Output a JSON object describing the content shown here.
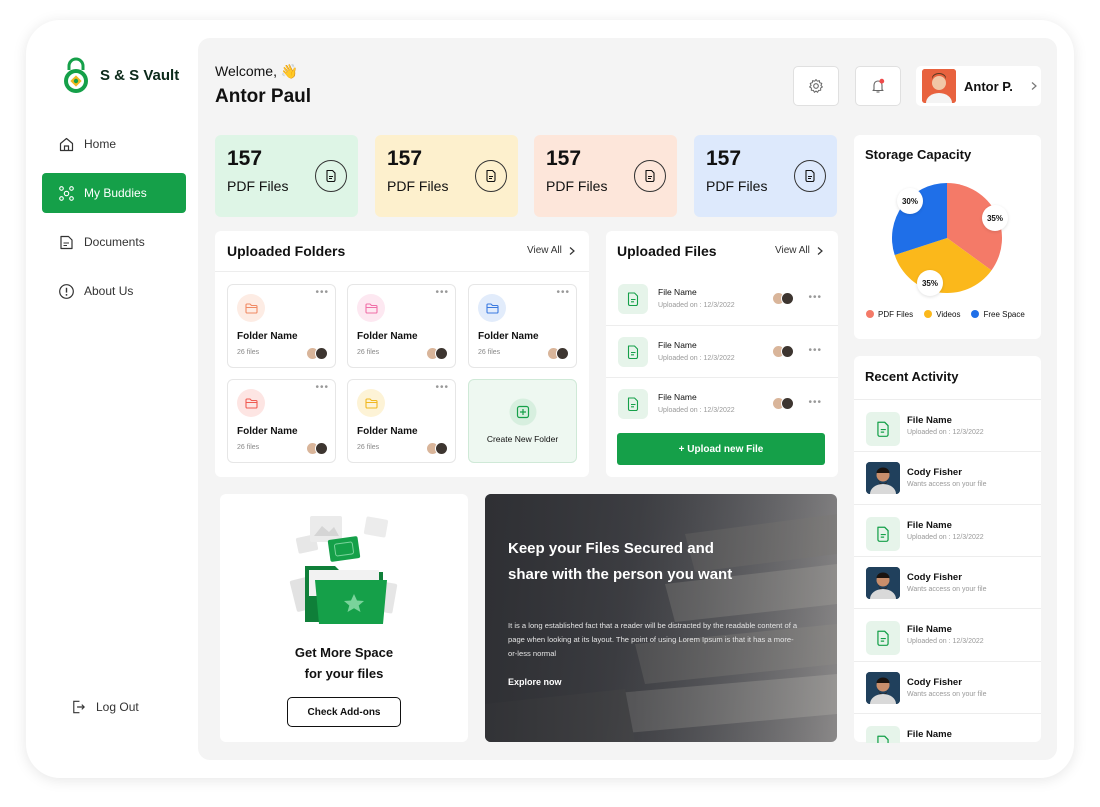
{
  "brand": {
    "name": "S & S Vault"
  },
  "sidebar": {
    "items": [
      {
        "label": "Home",
        "icon": "home-icon"
      },
      {
        "label": "My Buddies",
        "icon": "buddies-icon",
        "active": true
      },
      {
        "label": "Documents",
        "icon": "document-icon"
      },
      {
        "label": "About Us",
        "icon": "info-icon"
      }
    ],
    "logout_label": "Log Out"
  },
  "header": {
    "welcome": "Welcome, 👋",
    "user_name": "Antor Paul",
    "profile_name": "Antor P."
  },
  "stats": [
    {
      "value": "157",
      "label": "PDF Files",
      "color": "#def5e6"
    },
    {
      "value": "157",
      "label": "PDF Files",
      "color": "#fdf0cd"
    },
    {
      "value": "157",
      "label": "PDF Files",
      "color": "#fde6da"
    },
    {
      "value": "157",
      "label": "PDF Files",
      "color": "#dde9fc"
    }
  ],
  "folders": {
    "title": "Uploaded Folders",
    "view_all": "View All",
    "items": [
      {
        "name": "Folder Name",
        "count": "26 files",
        "color": "#f08a64",
        "bg": "#fdece4"
      },
      {
        "name": "Folder Name",
        "count": "26 files",
        "color": "#f06fa8",
        "bg": "#fde8f1"
      },
      {
        "name": "Folder Name",
        "count": "26 files",
        "color": "#3b7ae0",
        "bg": "#e2ecfb"
      },
      {
        "name": "Folder Name",
        "count": "26 files",
        "color": "#ef5b52",
        "bg": "#fde5e3"
      },
      {
        "name": "Folder Name",
        "count": "26 files",
        "color": "#f0b820",
        "bg": "#fdf3d6"
      }
    ],
    "create_label": "Create New Folder"
  },
  "files": {
    "title": "Uploaded Files",
    "view_all": "View All",
    "items": [
      {
        "name": "File Name",
        "date": "Uploaded on : 12/3/2022"
      },
      {
        "name": "File Name",
        "date": "Uploaded on : 12/3/2022"
      },
      {
        "name": "File Name",
        "date": "Uploaded on : 12/3/2022"
      }
    ],
    "upload_label": "+ Upload new File"
  },
  "promo": {
    "title_line1": "Get More Space",
    "title_line2": "for your files",
    "button": "Check Add-ons"
  },
  "hero": {
    "title": "Keep your Files Secured and share with the person you want",
    "text": "It is a long established fact that a reader will be distracted by the readable content of a page when looking at its layout. The point of using Lorem Ipsum is that it has a more-or-less normal",
    "link": "Explore now"
  },
  "storage": {
    "title": "Storage Capacity",
    "segments": [
      {
        "label": "PDF Files",
        "percent": 35,
        "color": "#f47a68",
        "display": "35%"
      },
      {
        "label": "Videos",
        "percent": 35,
        "color": "#fbb81b",
        "display": "35%"
      },
      {
        "label": "Free Space",
        "percent": 30,
        "color": "#1f6fe8",
        "display": "30%"
      }
    ]
  },
  "activity": {
    "title": "Recent Activity",
    "items": [
      {
        "type": "file",
        "name": "File Name",
        "sub": "Uploaded on : 12/3/2022"
      },
      {
        "type": "user",
        "name": "Cody Fisher",
        "sub": "Wants access on your file"
      },
      {
        "type": "file",
        "name": "File Name",
        "sub": "Uploaded on : 12/3/2022"
      },
      {
        "type": "user",
        "name": "Cody Fisher",
        "sub": "Wants access on your file"
      },
      {
        "type": "file",
        "name": "File Name",
        "sub": "Uploaded on : 12/3/2022"
      },
      {
        "type": "user",
        "name": "Cody Fisher",
        "sub": "Wants access on your file"
      },
      {
        "type": "file",
        "name": "File Name",
        "sub": ""
      }
    ]
  },
  "colors": {
    "accent": "#15a049",
    "background": "#f4f4f4"
  }
}
